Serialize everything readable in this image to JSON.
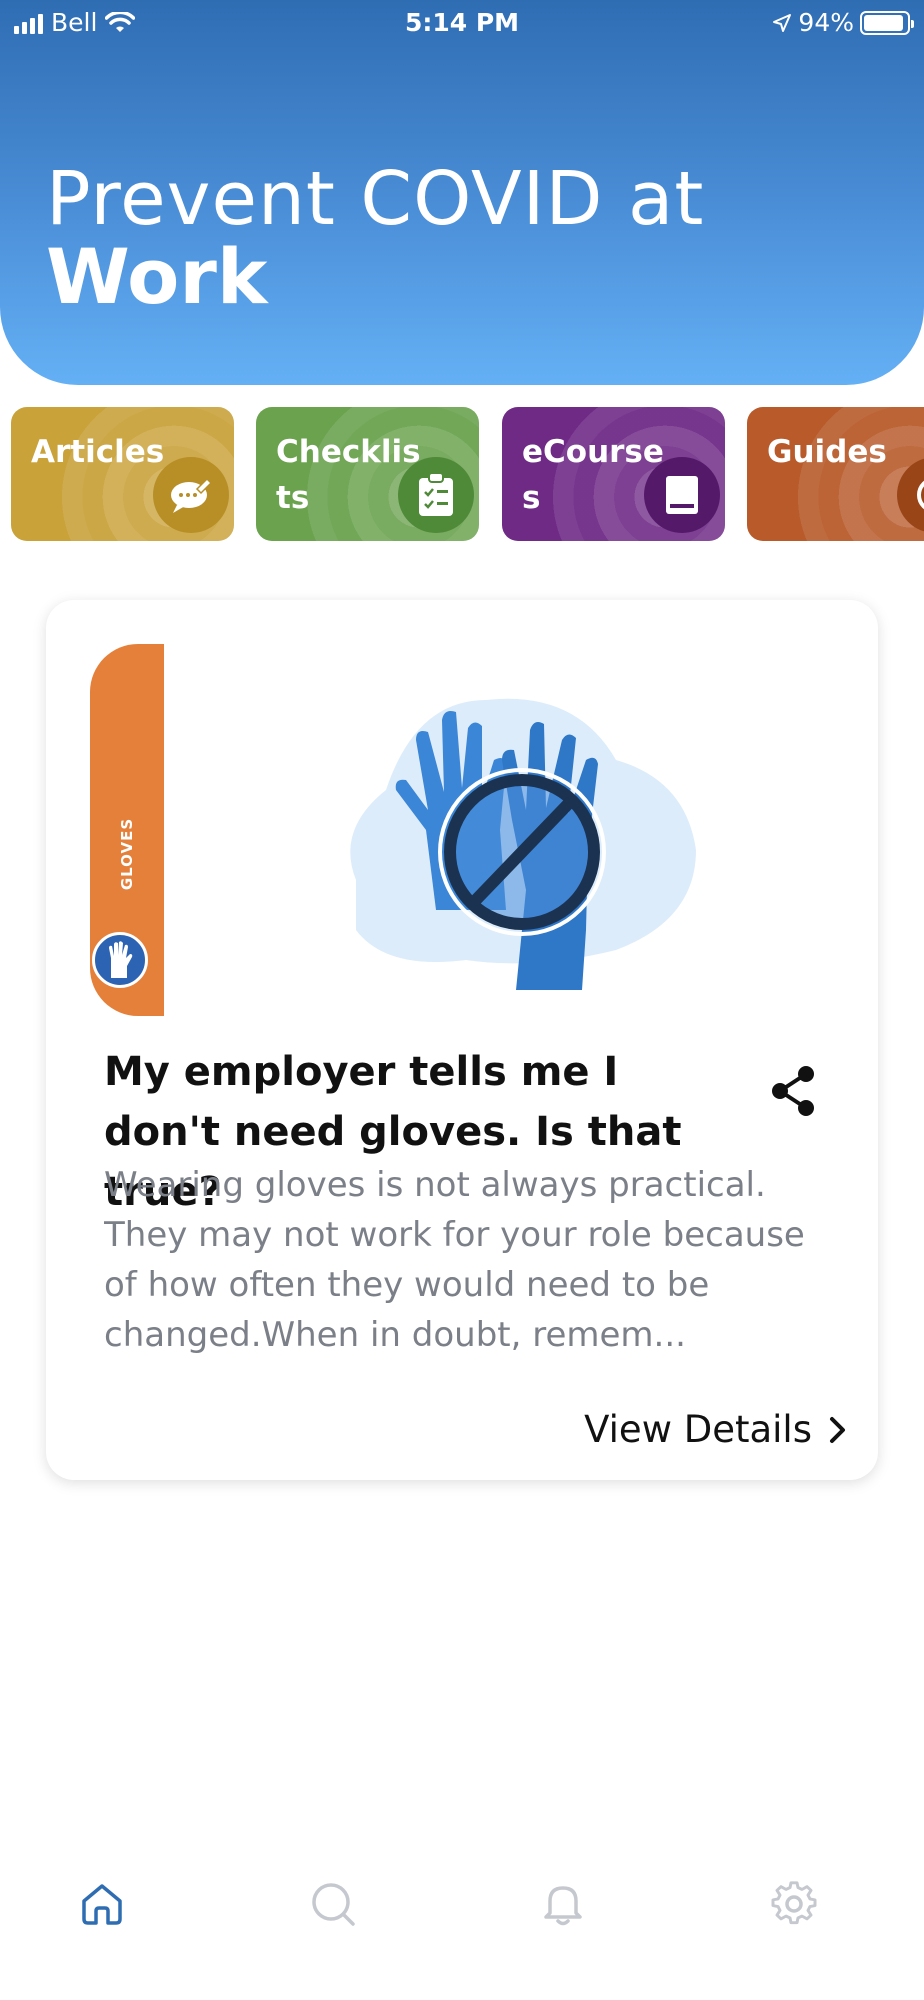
{
  "status_bar": {
    "carrier": "Bell",
    "time": "5:14 PM",
    "battery": "94%"
  },
  "header": {
    "title_line1": "Prevent COVID at",
    "title_line2": "Work"
  },
  "categories": [
    {
      "label": "Articles",
      "color": "#c9a23a",
      "icon": "chat-bubble-icon"
    },
    {
      "label": "Checklists",
      "color": "#6aa24e",
      "icon": "clipboard-checklist-icon"
    },
    {
      "label": "eCourses",
      "color": "#6f2a86",
      "icon": "book-icon"
    },
    {
      "label": "Guides",
      "color": "#b85a2a",
      "icon": "compass-icon"
    }
  ],
  "card": {
    "tag_label": "GLOVES",
    "tag_color": "#e5803a",
    "title": "My employer tells me I don't need gloves. Is that true?",
    "body": "Wearing gloves is not always practical. They may not work for your role because of how often they would need to be changed.When in doubt, remem...",
    "view_details": "View Details"
  },
  "bottom_nav": [
    {
      "name": "home",
      "icon": "home-icon",
      "active": true
    },
    {
      "name": "search",
      "icon": "search-icon",
      "active": false
    },
    {
      "name": "notifications",
      "icon": "bell-icon",
      "active": false
    },
    {
      "name": "settings",
      "icon": "gear-icon",
      "active": false
    }
  ],
  "colors": {
    "header_top": "#2f6db3",
    "header_bottom": "#64b0f5",
    "nav_active": "#2f6db3",
    "nav_inactive": "#c5c8ce"
  }
}
